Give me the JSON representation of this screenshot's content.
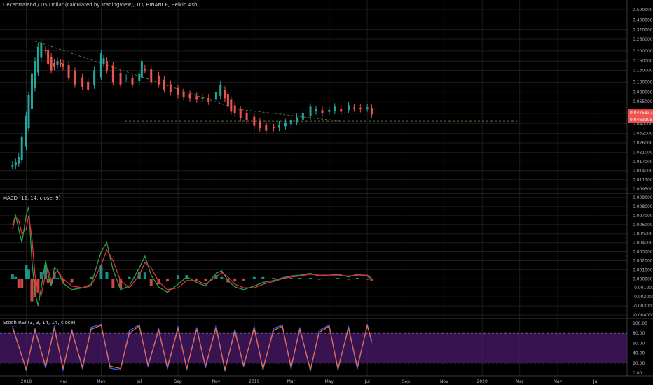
{
  "colors": {
    "background": "#000000",
    "grid": "#1c1c1c",
    "separator": "#3a3a3a",
    "up": "#26a69a",
    "down": "#ef5350",
    "price_tag": "#ef5350",
    "trendline": "#5b7a3a",
    "macd_line": "#2e9e4a",
    "signal_line": "#e0313f",
    "rsi_band": "#4a1a6e",
    "rsi_k": "#2962ff",
    "rsi_d": "#f06b3f"
  },
  "price_pane": {
    "title": "Decentraland / US Dollar (calculated by TradingView), 1D, BINANCE, Heikin Ashi",
    "price_tags": [
      "0.04753370",
      "0.04699055"
    ]
  },
  "macd_pane": {
    "title": "MACD (12, 14, close, 9)"
  },
  "rsi_pane": {
    "title": "Stoch RSI (3, 3, 14, 14, close)"
  },
  "x_axis": {
    "ticks": [
      "2018",
      "Mar",
      "May",
      "Jul",
      "Sep",
      "Nov",
      "2019",
      "Mar",
      "May",
      "Jul",
      "Sep",
      "Nov",
      "2020",
      "Mar",
      "May",
      "Jul"
    ]
  },
  "chart_data": [
    {
      "type": "candlestick",
      "title": "Decentraland / US Dollar (calculated by TradingView), 1D, BINANCE, Heikin Ashi",
      "y_scale": "log",
      "ylim": [
        0.0093,
        0.5
      ],
      "y_ticks": [
        "0.50000000",
        "0.40000000",
        "0.32000000",
        "0.26000000",
        "0.20000000",
        "0.16000000",
        "0.13000000",
        "0.10000000",
        "0.08000000",
        "0.06500000",
        "0.05000000",
        "0.04000000",
        "0.03200000",
        "0.02600000",
        "0.02100000",
        "0.01700000",
        "0.01400000",
        "0.01150000",
        "0.00930000"
      ],
      "x": [
        "2017-12-10",
        "2017-12-15",
        "2017-12-20",
        "2017-12-25",
        "2018-01-01",
        "2018-01-05",
        "2018-01-10",
        "2018-01-15",
        "2018-01-20",
        "2018-01-25",
        "2018-02-01",
        "2018-02-05",
        "2018-02-10",
        "2018-02-15",
        "2018-02-20",
        "2018-02-25",
        "2018-03-01",
        "2018-03-10",
        "2018-03-20",
        "2018-04-01",
        "2018-04-10",
        "2018-04-20",
        "2018-05-01",
        "2018-05-05",
        "2018-05-10",
        "2018-05-20",
        "2018-06-01",
        "2018-06-10",
        "2018-06-20",
        "2018-07-01",
        "2018-07-05",
        "2018-07-10",
        "2018-07-20",
        "2018-08-01",
        "2018-08-10",
        "2018-08-20",
        "2018-09-01",
        "2018-09-10",
        "2018-09-20",
        "2018-10-01",
        "2018-10-10",
        "2018-10-20",
        "2018-11-01",
        "2018-11-08",
        "2018-11-15",
        "2018-11-20",
        "2018-11-25",
        "2018-12-01",
        "2018-12-10",
        "2018-12-20",
        "2019-01-01",
        "2019-01-10",
        "2019-01-20",
        "2019-02-01",
        "2019-02-10",
        "2019-02-20",
        "2019-03-01",
        "2019-03-10",
        "2019-03-20",
        "2019-04-01",
        "2019-04-10",
        "2019-04-20",
        "2019-05-01",
        "2019-05-10",
        "2019-05-20",
        "2019-06-01",
        "2019-06-10",
        "2019-06-20",
        "2019-07-01",
        "2019-07-08"
      ],
      "close": [
        0.016,
        0.017,
        0.019,
        0.03,
        0.048,
        0.075,
        0.12,
        0.16,
        0.22,
        0.24,
        0.2,
        0.15,
        0.13,
        0.14,
        0.16,
        0.15,
        0.14,
        0.11,
        0.095,
        0.09,
        0.085,
        0.13,
        0.19,
        0.17,
        0.13,
        0.1,
        0.095,
        0.11,
        0.095,
        0.12,
        0.16,
        0.13,
        0.1,
        0.095,
        0.085,
        0.08,
        0.075,
        0.072,
        0.07,
        0.068,
        0.07,
        0.065,
        0.08,
        0.095,
        0.07,
        0.058,
        0.052,
        0.05,
        0.045,
        0.043,
        0.038,
        0.036,
        0.034,
        0.036,
        0.039,
        0.041,
        0.043,
        0.046,
        0.05,
        0.058,
        0.055,
        0.05,
        0.054,
        0.058,
        0.052,
        0.06,
        0.056,
        0.055,
        0.057,
        0.049
      ],
      "trendline_points": [
        [
          "2018-01-15",
          0.25
        ],
        [
          "2018-12-05",
          0.055
        ],
        [
          "2019-05-20",
          0.042
        ]
      ],
      "support_level": 0.042,
      "price_tags": [
        0.0475337,
        0.04699055
      ]
    },
    {
      "type": "line",
      "title": "MACD (12, 14, close, 9)",
      "ylim": [
        -0.004,
        0.009
      ],
      "y_ticks": [
        "0.00900000",
        "0.00800000",
        "0.00700000",
        "0.00600000",
        "0.00500000",
        "0.00400000",
        "0.00300000",
        "0.00200000",
        "0.00100000",
        "0.00000000",
        "-0.00100000",
        "-0.00200000",
        "-0.00300000",
        "-0.00400000"
      ],
      "x": [
        "2017-12-10",
        "2017-12-15",
        "2017-12-20",
        "2017-12-25",
        "2018-01-01",
        "2018-01-05",
        "2018-01-10",
        "2018-01-15",
        "2018-01-20",
        "2018-01-25",
        "2018-02-01",
        "2018-02-05",
        "2018-02-10",
        "2018-02-15",
        "2018-02-20",
        "2018-03-01",
        "2018-03-15",
        "2018-04-01",
        "2018-04-15",
        "2018-05-01",
        "2018-05-10",
        "2018-05-20",
        "2018-06-01",
        "2018-06-15",
        "2018-07-01",
        "2018-07-10",
        "2018-07-20",
        "2018-08-01",
        "2018-08-15",
        "2018-09-01",
        "2018-09-15",
        "2018-10-01",
        "2018-10-15",
        "2018-11-01",
        "2018-11-10",
        "2018-11-20",
        "2018-12-01",
        "2018-12-15",
        "2019-01-01",
        "2019-01-15",
        "2019-02-01",
        "2019-02-15",
        "2019-03-01",
        "2019-03-15",
        "2019-04-01",
        "2019-04-15",
        "2019-05-01",
        "2019-05-15",
        "2019-06-01",
        "2019-06-15",
        "2019-07-01",
        "2019-07-08"
      ],
      "series": [
        {
          "values": [
            0.006,
            0.007,
            0.0055,
            0.004,
            0.007,
            0.008,
            0.002,
            -0.0015,
            -0.003,
            -0.001,
            0.002,
            0.0005,
            -0.0008,
            0.0012,
            0.001,
            -0.0005,
            -0.0012,
            -0.001,
            -0.0006,
            0.003,
            0.004,
            0.001,
            -0.0012,
            -0.0008,
            0.0012,
            0.0025,
            0.0004,
            -0.0009,
            -0.0015,
            -0.0006,
            0.0002,
            -0.0004,
            -0.0008,
            0.0006,
            0.0009,
            -0.0002,
            -0.0009,
            -0.0012,
            -0.0008,
            -0.0004,
            -0.0002,
            0.0001,
            0.0003,
            0.0004,
            0.0006,
            0.0003,
            0.0004,
            0.0005,
            0.0002,
            0.0005,
            0.0003,
            -0.0001
          ]
        },
        {
          "values": [
            0.0055,
            0.0068,
            0.0065,
            0.005,
            0.0055,
            0.007,
            0.0045,
            0.0005,
            -0.0015,
            -0.0018,
            0.0005,
            0.001,
            -0.0002,
            0.0005,
            0.0009,
            0.0,
            -0.0008,
            -0.001,
            -0.0008,
            0.0015,
            0.0032,
            0.002,
            -0.0002,
            -0.001,
            0.0004,
            0.0018,
            0.0012,
            -0.0003,
            -0.0012,
            -0.001,
            -0.0002,
            -0.0002,
            -0.0006,
            0.0002,
            0.0007,
            0.0002,
            -0.0006,
            -0.001,
            -0.001,
            -0.0006,
            -0.0003,
            0.0,
            0.0002,
            0.0003,
            0.0005,
            0.0004,
            0.0004,
            0.0004,
            0.0003,
            0.0004,
            0.0004,
            0.0001
          ]
        }
      ]
    },
    {
      "type": "line",
      "title": "Stoch RSI (3, 3, 14, 14, close)",
      "ylim": [
        0,
        100
      ],
      "y_ticks": [
        "100.00",
        "80.00",
        "60.00",
        "40.00",
        "20.00",
        "0.00"
      ],
      "band": [
        20,
        80
      ],
      "x": [
        "2017-12-10",
        "2018-01-01",
        "2018-01-15",
        "2018-02-01",
        "2018-02-15",
        "2018-03-01",
        "2018-03-15",
        "2018-04-01",
        "2018-04-15",
        "2018-05-01",
        "2018-05-15",
        "2018-06-01",
        "2018-06-15",
        "2018-07-01",
        "2018-07-15",
        "2018-08-01",
        "2018-08-15",
        "2018-09-01",
        "2018-09-15",
        "2018-10-01",
        "2018-10-15",
        "2018-11-01",
        "2018-11-15",
        "2018-12-01",
        "2018-12-15",
        "2019-01-01",
        "2019-01-15",
        "2019-02-01",
        "2019-02-15",
        "2019-03-01",
        "2019-03-15",
        "2019-04-01",
        "2019-04-15",
        "2019-05-01",
        "2019-05-15",
        "2019-06-01",
        "2019-06-15",
        "2019-07-01",
        "2019-07-08"
      ],
      "series": [
        {
          "values": [
            95,
            5,
            90,
            10,
            95,
            5,
            88,
            8,
            92,
            98,
            10,
            6,
            85,
            97,
            12,
            90,
            8,
            94,
            6,
            92,
            10,
            96,
            4,
            88,
            12,
            94,
            6,
            90,
            96,
            8,
            92,
            4,
            86,
            96,
            6,
            94,
            8,
            98,
            60
          ]
        },
        {
          "values": [
            92,
            8,
            86,
            14,
            90,
            9,
            84,
            12,
            88,
            96,
            14,
            9,
            80,
            95,
            16,
            86,
            12,
            90,
            9,
            88,
            14,
            92,
            7,
            84,
            16,
            90,
            9,
            86,
            94,
            12,
            88,
            7,
            82,
            94,
            9,
            90,
            12,
            95,
            65
          ]
        }
      ]
    }
  ]
}
